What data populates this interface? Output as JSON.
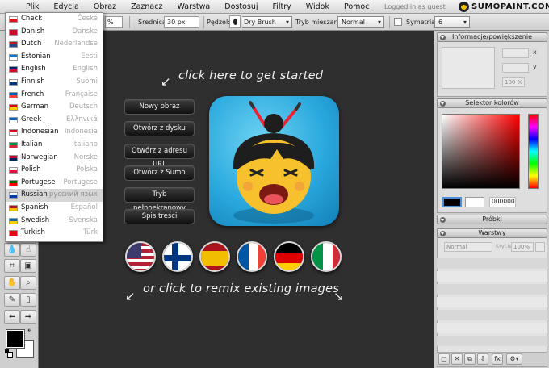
{
  "menubar": {
    "items": [
      "Plik",
      "Edycja",
      "Obraz",
      "Zaznacz",
      "Warstwa",
      "Dostosuj",
      "Filtry",
      "Widok",
      "Pomoc"
    ],
    "status": "Logged in as guest",
    "logo_text": "SUMOPAINT.COM"
  },
  "optbar": {
    "percent": "%",
    "size_label": "Średnica:",
    "size_value": "30 px",
    "brush_label": "Pędzel:",
    "brush_value": "Dry Brush",
    "blend_label": "Tryb mieszania:",
    "blend_value": "Normal",
    "symmetry_label": "Symetria",
    "symmetry_value": "6"
  },
  "languages": [
    {
      "en": "Check",
      "native": "České",
      "flag": [
        "#ffffff",
        "#d7141a"
      ]
    },
    {
      "en": "Danish",
      "native": "Danske",
      "flag": [
        "#c60c30",
        "#c60c30"
      ]
    },
    {
      "en": "Dutch",
      "native": "Nederlandse",
      "flag": [
        "#ae1c28",
        "#21468b"
      ]
    },
    {
      "en": "Estonian",
      "native": "Eesti",
      "flag": [
        "#0072ce",
        "#ffffff"
      ]
    },
    {
      "en": "English",
      "native": "English",
      "flag": [
        "#012169",
        "#c8102e"
      ]
    },
    {
      "en": "Finnish",
      "native": "Suomi",
      "flag": [
        "#ffffff",
        "#003580"
      ]
    },
    {
      "en": "French",
      "native": "Française",
      "flag": [
        "#0055a4",
        "#ef4135"
      ]
    },
    {
      "en": "German",
      "native": "Deutsch",
      "flag": [
        "#dd0000",
        "#ffce00"
      ]
    },
    {
      "en": "Greek",
      "native": "Ελληνικά",
      "flag": [
        "#0d5eaf",
        "#ffffff"
      ]
    },
    {
      "en": "Indonesian",
      "native": "Indonesia",
      "flag": [
        "#ce1126",
        "#ffffff"
      ]
    },
    {
      "en": "Italian",
      "native": "Italiano",
      "flag": [
        "#009246",
        "#ce2b37"
      ]
    },
    {
      "en": "Norwegian",
      "native": "Norske",
      "flag": [
        "#ba0c2f",
        "#00205b"
      ]
    },
    {
      "en": "Polish",
      "native": "Polska",
      "flag": [
        "#ffffff",
        "#dc143c"
      ]
    },
    {
      "en": "Portugese",
      "native": "Portugese",
      "flag": [
        "#006600",
        "#ff0000"
      ]
    },
    {
      "en": "Russian",
      "native": "русский язык",
      "flag": [
        "#ffffff",
        "#0039a6"
      ],
      "selected": true
    },
    {
      "en": "Spanish",
      "native": "Español",
      "flag": [
        "#aa151b",
        "#f1bf00"
      ]
    },
    {
      "en": "Swedish",
      "native": "Svenska",
      "flag": [
        "#006aa7",
        "#fecc00"
      ]
    },
    {
      "en": "Turkish",
      "native": "Türk",
      "flag": [
        "#e30a17",
        "#e30a17"
      ]
    }
  ],
  "canvas": {
    "hint_top": "click here to get started",
    "hint_bottom": "or click to remix existing images",
    "buttons": [
      "Nowy obraz",
      "Otwórz z dysku",
      "Otwórz z adresu URL",
      "Otwórz z Sumo",
      "Tryb pełnoekranowy",
      "Spis treści"
    ],
    "flags": [
      {
        "name": "usa",
        "colors": [
          "#b22234",
          "#ffffff",
          "#3c3b6e"
        ]
      },
      {
        "name": "finland",
        "colors": [
          "#ffffff",
          "#003580"
        ]
      },
      {
        "name": "spain",
        "colors": [
          "#aa151b",
          "#f1bf00"
        ]
      },
      {
        "name": "france",
        "colors": [
          "#0055a4",
          "#ffffff",
          "#ef4135"
        ]
      },
      {
        "name": "germany",
        "colors": [
          "#000000",
          "#dd0000",
          "#ffce00"
        ]
      },
      {
        "name": "italy",
        "colors": [
          "#009246",
          "#ffffff",
          "#ce2b37"
        ]
      }
    ]
  },
  "panels": {
    "info_title": "Informacje/powiększenie",
    "x_label": "x",
    "y_label": "y",
    "zoom_value": "100 %",
    "colors_title": "Selektor kolorów",
    "hex_value": "000000",
    "samples_title": "Próbki",
    "layers_title": "Warstwy",
    "layer_blend": "Normal",
    "opacity_label": "Krycie:",
    "opacity_value": "100%"
  },
  "colors": {
    "foreground": "#000000",
    "background": "#ffffff"
  }
}
